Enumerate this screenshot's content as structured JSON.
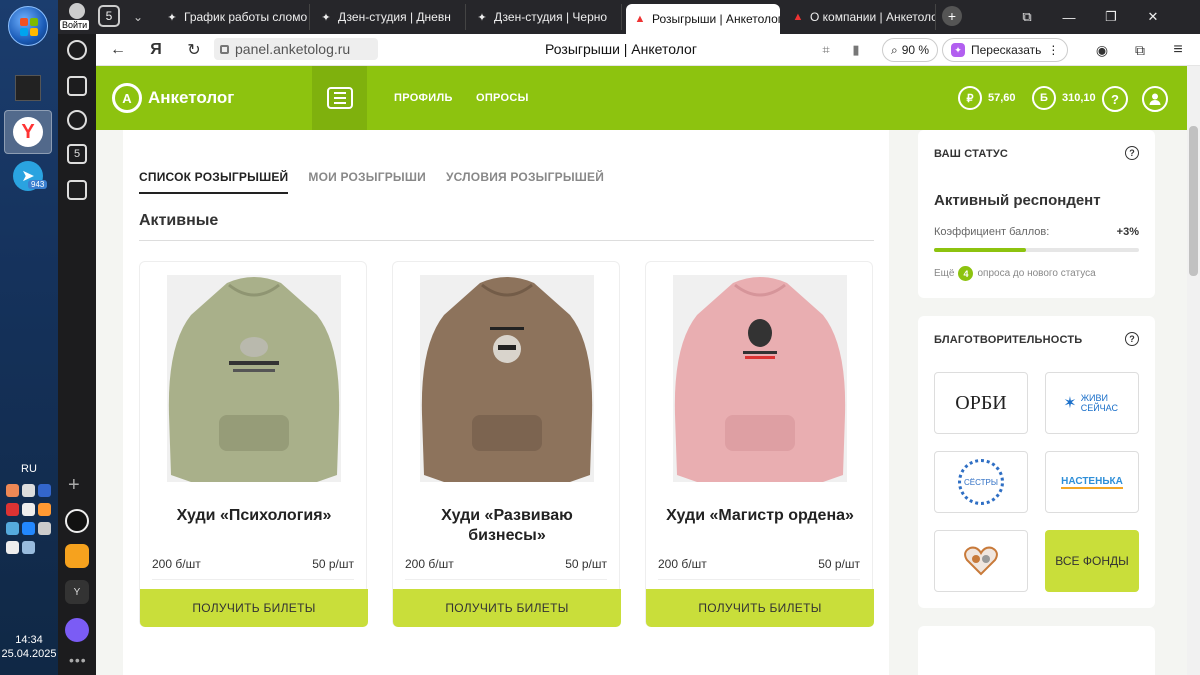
{
  "taskbar": {
    "language": "RU",
    "time": "14:34",
    "date": "25.04.2025",
    "telegram_badge": "943"
  },
  "browser": {
    "profile_label": "Войти",
    "tab_counter": "5",
    "tabs": [
      {
        "title": "График работы сломо",
        "icon": "sparkle-icon"
      },
      {
        "title": "Дзен-студия | Дневн",
        "icon": "sparkle-icon"
      },
      {
        "title": "Дзен-студия | Черно",
        "icon": "sparkle-icon"
      },
      {
        "title": "Розыгрыши | Анкетолог",
        "icon": "anketolog-icon"
      },
      {
        "title": "О компании | Анкетолог",
        "icon": "anketolog-icon"
      }
    ],
    "url": "panel.anketolog.ru",
    "page_title": "Розыгрыши | Анкетолог",
    "zoom": "90 %",
    "retell_label": "Пересказать",
    "side_counter": "5"
  },
  "site": {
    "logo_text": "Анкетолог",
    "logo_letter": "А",
    "nav": [
      "ПРОФИЛЬ",
      "ОПРОСЫ"
    ],
    "balance_rub": "57,60",
    "balance_rub_symbol": "₽",
    "balance_bonus": "310,10",
    "balance_bonus_symbol": "Б",
    "help_symbol": "?"
  },
  "raffles": {
    "tabs": [
      "СПИСОК РОЗЫГРЫШЕЙ",
      "МОИ РОЗЫГРЫШИ",
      "УСЛОВИЯ РОЗЫГРЫШЕЙ"
    ],
    "active_tab_index": 0,
    "section_title": "Активные",
    "cards": [
      {
        "title": "Худи «Психология»",
        "price_bonus": "200 б/шт",
        "price_rub": "50 р/шт",
        "button": "ПОЛУЧИТЬ БИЛЕТЫ",
        "hoodie_color": "#a9b08a"
      },
      {
        "title": "Худи «Развиваю бизнесы»",
        "price_bonus": "200 б/шт",
        "price_rub": "50 р/шт",
        "button": "ПОЛУЧИТЬ БИЛЕТЫ",
        "hoodie_color": "#8d735c"
      },
      {
        "title": "Худи «Магистр ордена»",
        "price_bonus": "200 б/шт",
        "price_rub": "50 р/шт",
        "button": "ПОЛУЧИТЬ БИЛЕТЫ",
        "hoodie_color": "#e9aeb1"
      }
    ]
  },
  "status": {
    "heading": "ВАШ СТАТУС",
    "name": "Активный респондент",
    "coef_label": "Коэффициент баллов:",
    "coef_value": "+3%",
    "progress": 0.45,
    "more_prefix": "Ещё",
    "more_count": "4",
    "more_suffix": "опроса до нового статуса"
  },
  "charity": {
    "heading": "БЛАГОТВОРИТЕЛЬНОСТЬ",
    "funds": [
      "ОРБИ",
      "ЖИВИ СЕЙЧАС",
      "СЁСТРЫ",
      "НАСТЕНЬКА"
    ],
    "all_button": "ВСЕ ФОНДЫ"
  }
}
